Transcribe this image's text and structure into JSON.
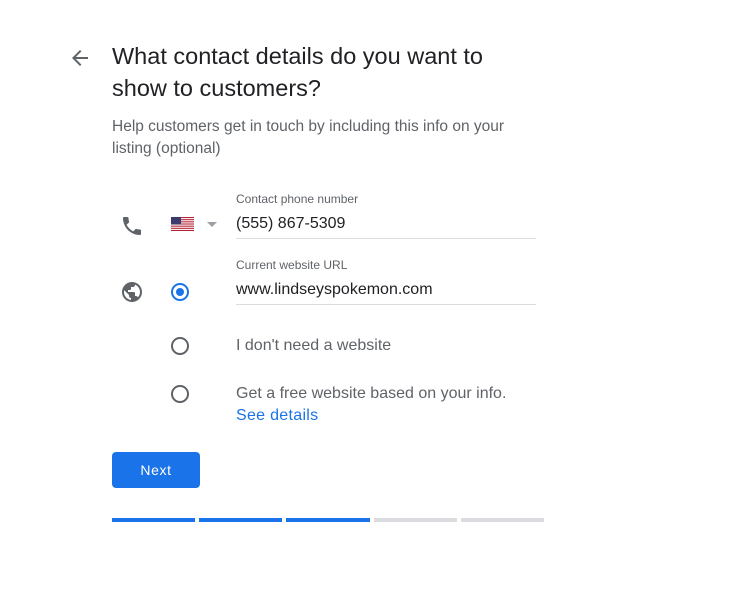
{
  "header": {
    "back_icon": "arrow-back-icon",
    "title": "What contact details do you want to show to customers?",
    "subtitle": "Help customers get in touch by including this info on your listing (optional)"
  },
  "phone": {
    "icon": "phone-icon",
    "country_flag": "us-flag",
    "label": "Contact phone number",
    "value": "(555) 867-5309"
  },
  "website": {
    "icon": "globe-icon",
    "label": "Current website URL",
    "value": "www.lindseyspokemon.com",
    "options": [
      {
        "id": "current",
        "selected": true
      },
      {
        "id": "none",
        "label": "I don't need a website",
        "selected": false
      },
      {
        "id": "free",
        "label": "Get a free website based on your info.",
        "link": "See details",
        "selected": false
      }
    ]
  },
  "actions": {
    "next_label": "Next"
  },
  "progress": {
    "total_steps": 5,
    "completed_steps": 3
  },
  "colors": {
    "accent": "#1a73e8",
    "text_primary": "#202124",
    "text_secondary": "#5f6368",
    "divider": "#dadce0"
  }
}
